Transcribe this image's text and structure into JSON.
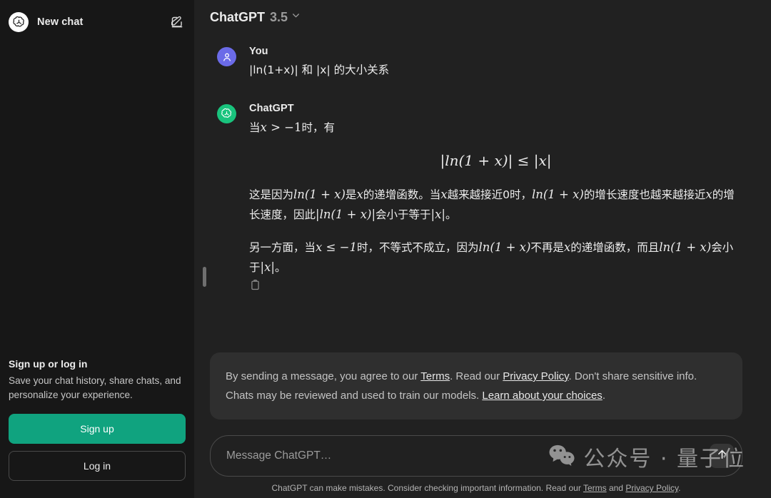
{
  "colors": {
    "sidebar_bg": "#171717",
    "main_bg": "#212121",
    "accent_green": "#10a37f",
    "gpt_avatar_green": "#19c37d",
    "user_avatar_purple": "#6b6be8",
    "panel_gray": "#2f2f2f"
  },
  "sidebar": {
    "new_chat_label": "New chat",
    "brand_icon": "openai-logo-icon",
    "compose_icon": "compose-icon",
    "auth": {
      "title": "Sign up or log in",
      "description": "Save your chat history, share chats, and personalize your experience.",
      "signup_label": "Sign up",
      "login_label": "Log in"
    }
  },
  "topbar": {
    "model_name": "ChatGPT",
    "model_version": "3.5",
    "chevron_icon": "chevron-down-icon"
  },
  "conversation": [
    {
      "author": "You",
      "avatar_icon": "user-avatar-icon",
      "text": "|ln(1+x)| 和 |x| 的大小关系"
    },
    {
      "author": "ChatGPT",
      "avatar_icon": "openai-logo-icon",
      "intro_prefix": "当",
      "intro_var": "x",
      "intro_rel": " > −1",
      "intro_suffix": "时，有",
      "display_math": "|ln(1 + x)| ≤ |x|",
      "paragraph_1": {
        "seg_1": "这是因为",
        "math_1": "ln(1 + x)",
        "seg_2": "是",
        "math_2": "x",
        "seg_3": "的递增函数。当",
        "math_3": "x",
        "seg_4": "越来越接近0时，",
        "math_4": "ln(1 + x)",
        "seg_5": "的增长速度也越来越接近",
        "math_5": "x",
        "seg_6": "的增长速度，因此",
        "math_6": "|ln(1 + x)|",
        "seg_7": "会小于等于",
        "math_7": "|x|",
        "seg_8": "。"
      },
      "paragraph_2": {
        "seg_1": "另一方面，当",
        "math_1": "x ≤ −1",
        "seg_2": "时，不等式不成立，因为",
        "math_2": "ln(1 + x)",
        "seg_3": "不再是",
        "math_3": "x",
        "seg_4": "的递增函数，而且",
        "math_4": "ln(1 + x)",
        "seg_5": "会小于",
        "math_5": "|x|",
        "seg_6": "。"
      },
      "copy_icon": "copy-icon"
    }
  ],
  "disclaimer": {
    "part_1": "By sending a message, you agree to our ",
    "link_terms": "Terms",
    "part_2": ". Read our ",
    "link_privacy": "Privacy Policy",
    "part_3": ". Don't share sensitive info. Chats may be reviewed and used to train our models. ",
    "link_choices": "Learn about your choices",
    "part_4": "."
  },
  "composer": {
    "placeholder": "Message ChatGPT…",
    "send_icon": "send-arrow-up-icon"
  },
  "footnote": {
    "part_1": "ChatGPT can make mistakes. Consider checking important information. Read our ",
    "link_terms": "Terms",
    "part_2": " and ",
    "link_privacy": "Privacy Policy",
    "part_3": "."
  },
  "watermark": {
    "icon": "wechat-icon",
    "text": "公众号 · 量子位"
  }
}
